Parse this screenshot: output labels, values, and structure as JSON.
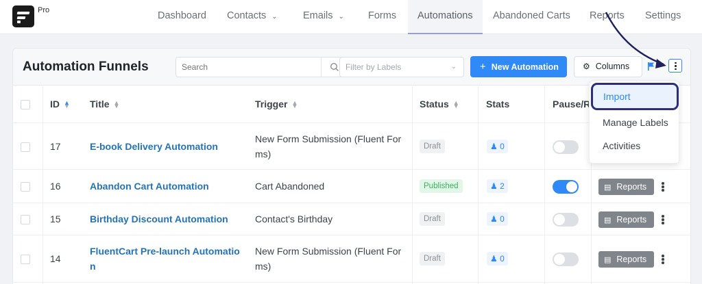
{
  "app": {
    "badge": "Pro"
  },
  "nav": [
    {
      "label": "Dashboard"
    },
    {
      "label": "Contacts"
    },
    {
      "label": "Emails"
    },
    {
      "label": "Forms"
    },
    {
      "label": "Automations"
    },
    {
      "label": "Abandoned Carts"
    },
    {
      "label": "Reports"
    },
    {
      "label": "Settings"
    }
  ],
  "header": {
    "title": "Automation Funnels",
    "search_placeholder": "Search",
    "filter_placeholder": "Filter by Labels",
    "new_button": "New Automation",
    "columns_button": "Columns"
  },
  "columns": {
    "id": "ID",
    "title": "Title",
    "trigger": "Trigger",
    "status": "Status",
    "stats": "Stats",
    "pause": "Pause/R"
  },
  "rows": [
    {
      "id": "17",
      "title": "E-book Delivery Automation",
      "trigger_line1": "New Form Submission (Fluent For",
      "trigger_line2": "ms)",
      "status": "Draft",
      "stats": "0",
      "enabled": false
    },
    {
      "id": "16",
      "title": "Abandon Cart Automation",
      "trigger_line1": "Cart Abandoned",
      "trigger_line2": "",
      "status": "Published",
      "stats": "2",
      "enabled": true,
      "reports": "Reports"
    },
    {
      "id": "15",
      "title": "Birthday Discount Automation",
      "trigger_line1": "Contact's Birthday",
      "trigger_line2": "",
      "status": "Draft",
      "stats": "0",
      "enabled": false,
      "reports": "Reports"
    },
    {
      "id": "14",
      "title_line1": "FluentCart Pre-launch Automatio",
      "title_line2": "n",
      "trigger_line1": "New Form Submission (Fluent For",
      "trigger_line2": "ms)",
      "status": "Draft",
      "stats": "0",
      "enabled": false,
      "reports": "Reports"
    }
  ],
  "dropdown": {
    "items": [
      "Import",
      "Manage Labels",
      "Activities"
    ]
  },
  "colors": {
    "accent": "#2f89f6",
    "highlight_border": "#2c2f77",
    "published": "#38b45d"
  }
}
